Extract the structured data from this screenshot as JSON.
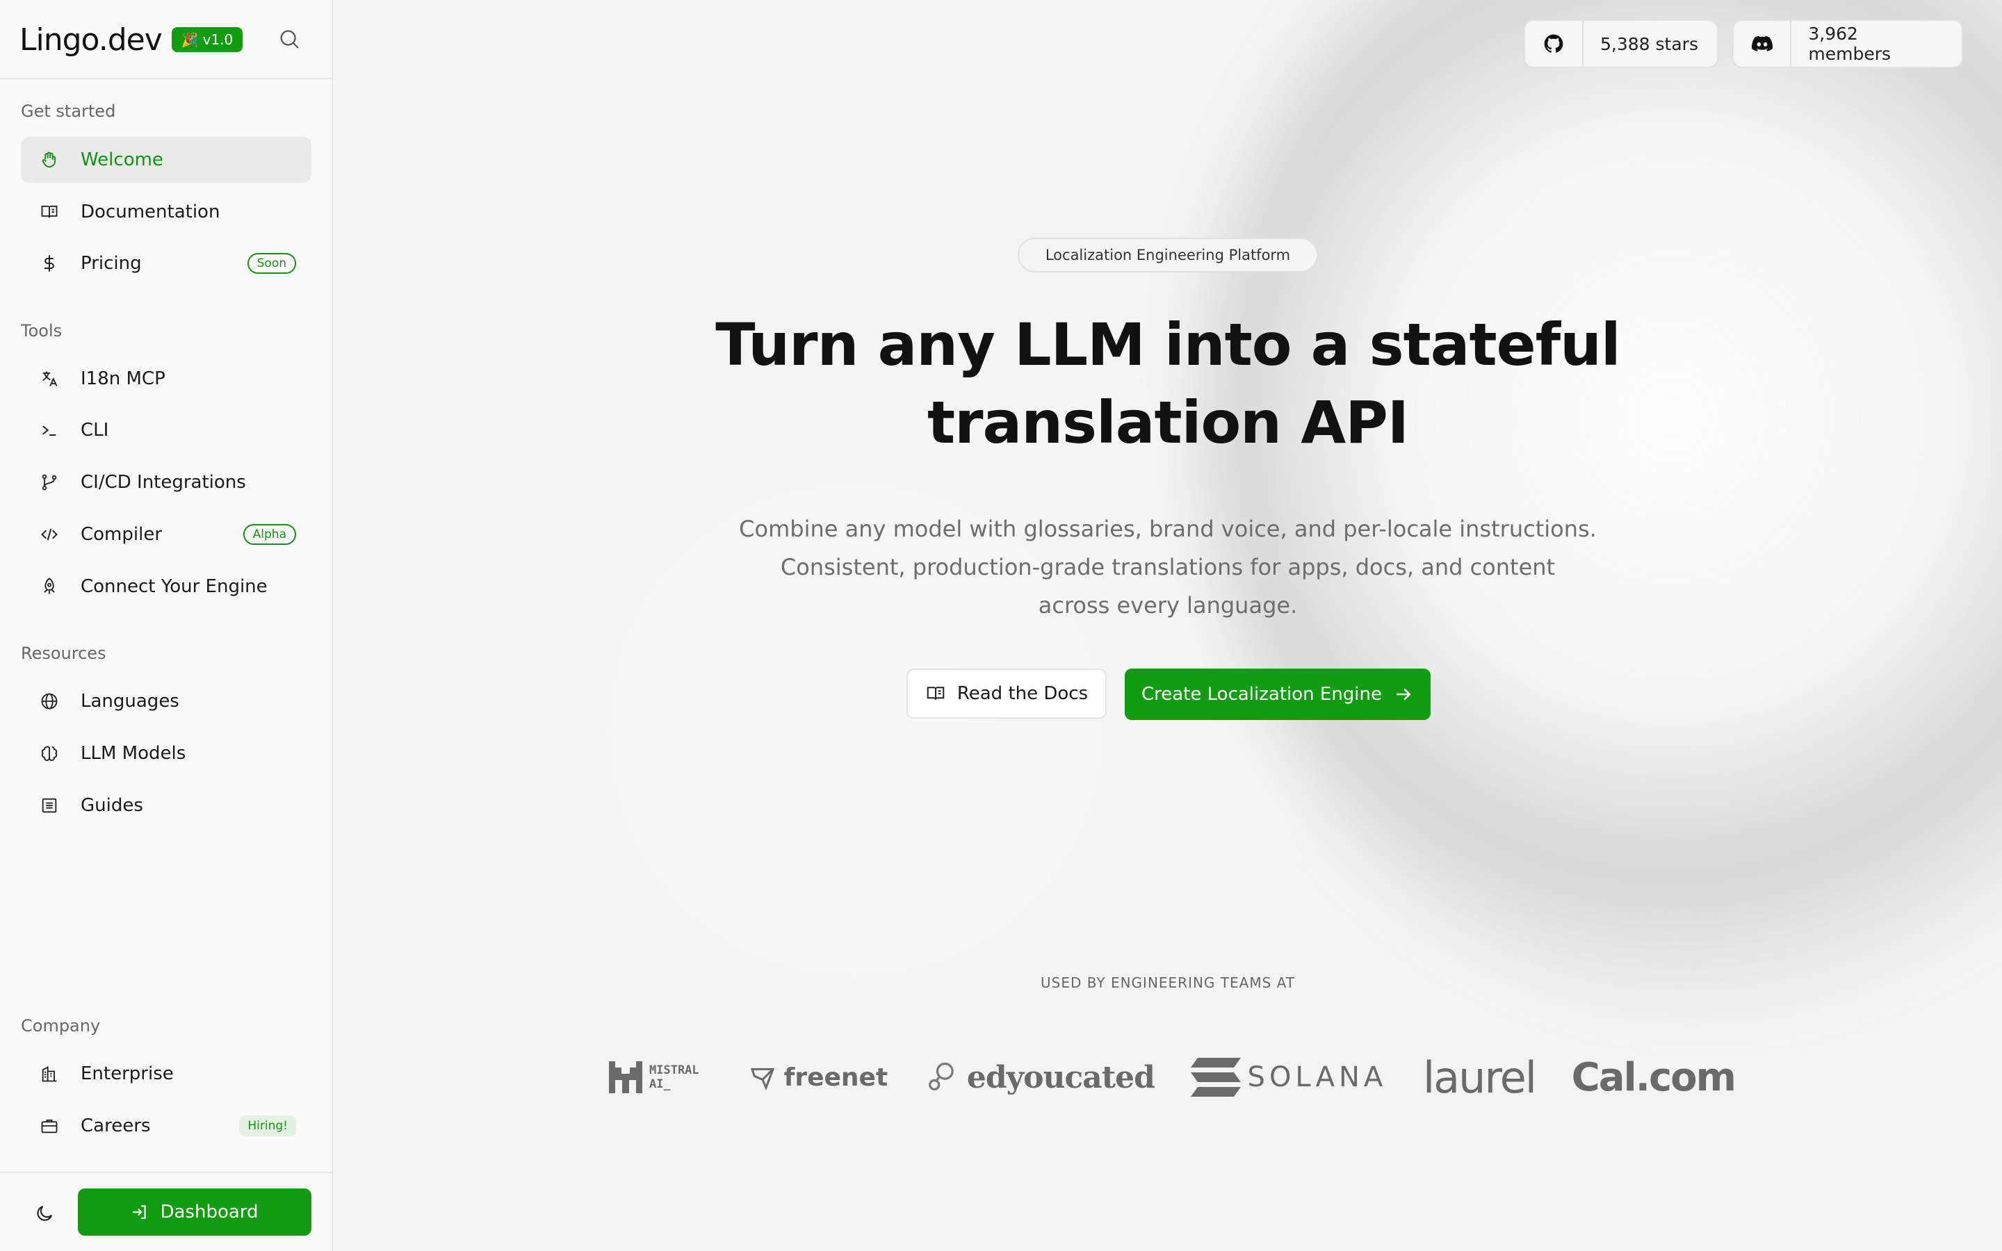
{
  "brand": {
    "name": "Lingo.dev",
    "version": "v1.0",
    "version_emoji": "🎉"
  },
  "sidebar": {
    "sections": {
      "get_started": "Get started",
      "tools": "Tools",
      "resources": "Resources",
      "company": "Company"
    },
    "items": [
      {
        "label": "Welcome",
        "icon": "waving-hand-icon",
        "active": true
      },
      {
        "label": "Documentation",
        "icon": "book-icon"
      },
      {
        "label": "Pricing",
        "icon": "dollar-icon",
        "badge": "Soon"
      },
      {
        "label": "I18n MCP",
        "icon": "translate-icon"
      },
      {
        "label": "CLI",
        "icon": "terminal-icon"
      },
      {
        "label": "CI/CD Integrations",
        "icon": "git-branch-icon"
      },
      {
        "label": "Compiler",
        "icon": "code-icon",
        "badge": "Alpha"
      },
      {
        "label": "Connect Your Engine",
        "icon": "rocket-icon"
      },
      {
        "label": "Languages",
        "icon": "globe-icon"
      },
      {
        "label": "LLM Models",
        "icon": "brain-icon"
      },
      {
        "label": "Guides",
        "icon": "newspaper-icon"
      },
      {
        "label": "Enterprise",
        "icon": "building-icon"
      },
      {
        "label": "Careers",
        "icon": "briefcase-icon",
        "badge": "Hiring!"
      }
    ],
    "dashboard_label": "Dashboard"
  },
  "header": {
    "github_stars": "5,388 stars",
    "discord_members": "3,962 members"
  },
  "hero": {
    "tag": "Localization Engineering Platform",
    "title_line1": "Turn any LLM into a stateful",
    "title_line2": "translation API",
    "subtitle_line1": "Combine any model with glossaries, brand voice, and per-locale instructions.",
    "subtitle_line2": "Consistent, production-grade translations for apps, docs, and content",
    "subtitle_line3": "across every language.",
    "btn_docs": "Read the Docs",
    "btn_create": "Create Localization Engine"
  },
  "customers": {
    "title": "USED BY ENGINEERING TEAMS AT",
    "logos": [
      "MISTRAL AI_",
      "freenet",
      "edyoucated",
      "SOLANA",
      "laurel",
      "Cal.com"
    ]
  },
  "colors": {
    "accent": "#129c12",
    "background": "#f3f3f3",
    "sidebar": "#fafafa"
  }
}
